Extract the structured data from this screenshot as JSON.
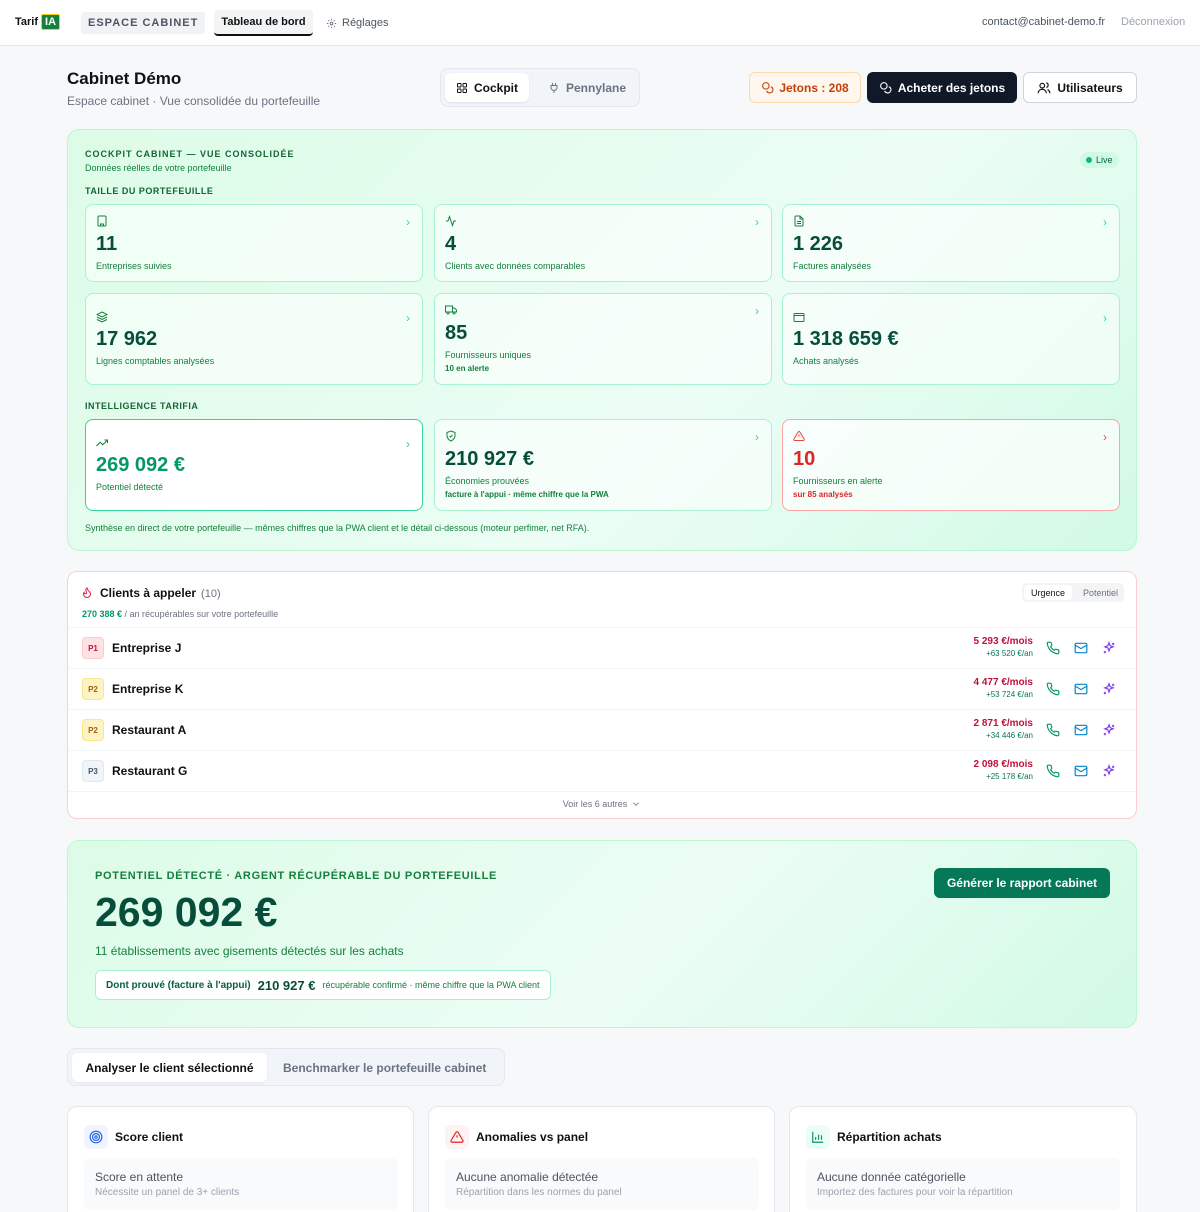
{
  "nav": {
    "logo_text": "Tarif",
    "logo_badge": "IA",
    "cabinet_label": "ESPACE CABINET",
    "tabs": [
      {
        "label": "Tableau de bord"
      },
      {
        "label": "Réglages"
      }
    ],
    "email": "contact@cabinet-demo.fr",
    "logout": "Déconnexion"
  },
  "header": {
    "title": "Cabinet Démo",
    "subtitle": "Espace cabinet · Vue consolidée du portefeuille",
    "segments": [
      {
        "label": "Cockpit",
        "active": true
      },
      {
        "label": "Pennylane",
        "active": false
      }
    ],
    "tokens_label": "Jetons : 208",
    "buy_label": "Acheter des jetons",
    "users_label": "Utilisateurs"
  },
  "cockpit": {
    "title": "COCKPIT CABINET — VUE CONSOLIDÉE",
    "subtitle": "Données réelles de votre portefeuille",
    "live": "Live",
    "section_size": "TAILLE DU PORTEFEUILLE",
    "section_intel": "INTELLIGENCE TARIFIA",
    "size_cards": [
      {
        "value": "11",
        "label": "Entreprises suivies",
        "icon": "building-icon"
      },
      {
        "value": "4",
        "label": "Clients avec données comparables",
        "icon": "activity-icon"
      },
      {
        "value": "1 226",
        "label": "Factures analysées",
        "icon": "document-icon"
      },
      {
        "value": "17 962",
        "label": "Lignes comptables analysées",
        "icon": "layers-icon"
      },
      {
        "value": "85",
        "label": "Fournisseurs uniques",
        "extra": "10 en alerte",
        "icon": "truck-icon"
      },
      {
        "value": "1 318 659 €",
        "label": "Achats analysés",
        "icon": "wallet-icon"
      }
    ],
    "intel_cards": [
      {
        "value": "269 092 €",
        "label": "Potentiel détecté",
        "icon": "trending-up-icon"
      },
      {
        "value": "210 927 €",
        "label": "Économies prouvées",
        "extra": "facture à l'appui · même chiffre que la PWA",
        "icon": "shield-check-icon"
      },
      {
        "value": "10",
        "label": "Fournisseurs en alerte",
        "extra": "sur 85 analysés",
        "icon": "alert-triangle-icon"
      }
    ],
    "footnote": "Synthèse en direct de votre portefeuille — mêmes chiffres que la PWA client et le détail ci-dessous (moteur perfimer, net RFA)."
  },
  "calls": {
    "title": "Clients à appeler",
    "count": "(10)",
    "sub_amount": "270 388 €",
    "sub_text": " / an récupérables sur votre portefeuille",
    "toggle": [
      "Urgence",
      "Potentiel"
    ],
    "rows": [
      {
        "prio": "P1",
        "name": "Entreprise J",
        "month": "5 293 €/mois",
        "year": "+63 520 €/an"
      },
      {
        "prio": "P2",
        "name": "Entreprise K",
        "month": "4 477 €/mois",
        "year": "+53 724 €/an"
      },
      {
        "prio": "P2",
        "name": "Restaurant A",
        "month": "2 871 €/mois",
        "year": "+34 446 €/an"
      },
      {
        "prio": "P3",
        "name": "Restaurant G",
        "month": "2 098 €/mois",
        "year": "+25 178 €/an"
      }
    ],
    "more": "Voir les 6 autres"
  },
  "potential": {
    "label": "POTENTIEL DÉTECTÉ · ARGENT RÉCUPÉRABLE DU PORTEFEUILLE",
    "value": "269 092 €",
    "sub": "11 établissements avec gisements détectés sur les achats",
    "proved_label": "Dont prouvé (facture à l'appui)",
    "proved_value": "210 927 €",
    "proved_note": "récupérable confirmé · même chiffre que la PWA client",
    "button": "Générer le rapport cabinet"
  },
  "analysis_tabs": [
    {
      "label": "Analyser le client sélectionné",
      "active": true
    },
    {
      "label": "Benchmarker le portefeuille cabinet",
      "active": false
    }
  ],
  "bottom_cards": [
    {
      "title": "Score client",
      "line1": "Score en attente",
      "line2": "Nécessite un panel de 3+ clients",
      "icon": "target-icon"
    },
    {
      "title": "Anomalies vs panel",
      "line1": "Aucune anomalie détectée",
      "line2": "Répartition dans les normes du panel",
      "icon": "alert-triangle-icon"
    },
    {
      "title": "Répartition achats",
      "line1": "Aucune donnée catégorielle",
      "line2": "Importez des factures pour voir la répartition",
      "icon": "bar-chart-icon"
    }
  ],
  "colors": {
    "brand_green": "#047857",
    "dark": "#111827",
    "alert_red": "#dc2626",
    "token_orange": "#c2410c"
  }
}
